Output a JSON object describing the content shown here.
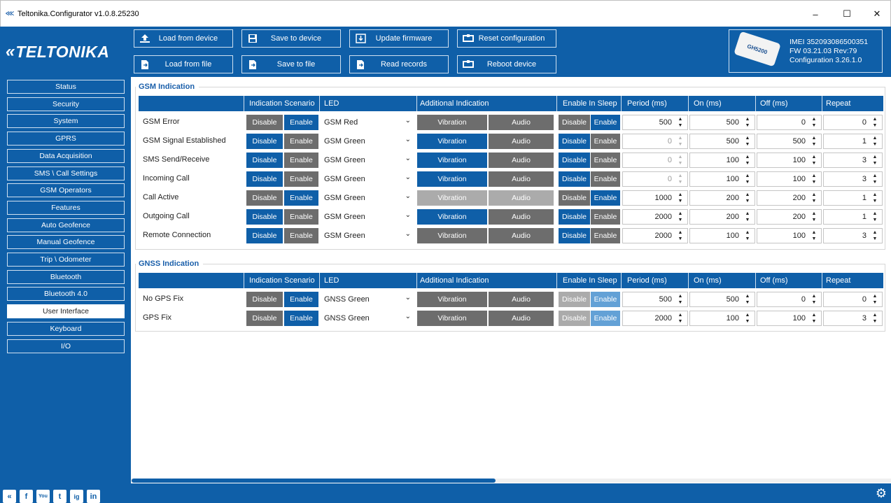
{
  "window": {
    "title": "Teltonika.Configurator v1.0.8.25230",
    "minimize": "–",
    "maximize": "☐",
    "close": "✕"
  },
  "brand": {
    "mark": "«",
    "name": "TELTONIKA"
  },
  "toolbar": {
    "load_device": "Load from device",
    "save_device": "Save to device",
    "update_fw": "Update firmware",
    "reset_cfg": "Reset configuration",
    "load_file": "Load from file",
    "save_file": "Save to file",
    "read_records": "Read records",
    "reboot": "Reboot device"
  },
  "device": {
    "model": "GH5200",
    "imei": "IMEI 352093086500351",
    "fw": "FW 03.21.03 Rev:79",
    "config": "Configuration 3.26.1.0"
  },
  "sidebar": {
    "items": [
      "Status",
      "Security",
      "System",
      "GPRS",
      "Data Acquisition",
      "SMS \\ Call Settings",
      "GSM Operators",
      "Features",
      "Auto Geofence",
      "Manual Geofence",
      "Trip \\ Odometer",
      "Bluetooth",
      "Bluetooth 4.0",
      "User Interface",
      "Keyboard",
      "I/O"
    ],
    "active": "User Interface"
  },
  "social": [
    "«",
    "f",
    "You",
    "t",
    "ig",
    "in"
  ],
  "columns": {
    "scenario": "Indication Scenario",
    "led": "LED",
    "additional": "Additional Indication",
    "sleep": "Enable In Sleep",
    "period": "Period (ms)",
    "on": "On (ms)",
    "off": "Off (ms)",
    "repeat": "Repeat"
  },
  "labels": {
    "disable": "Disable",
    "enable": "Enable",
    "vibration": "Vibration",
    "audio": "Audio"
  },
  "gsm": {
    "title": "GSM Indication",
    "rows": [
      {
        "name": "GSM Error",
        "scenario": "Enable",
        "led": "GSM Red",
        "vibration": "off",
        "audio": "off",
        "sleep": "Enable",
        "period": "500",
        "on": "500",
        "off": "0",
        "repeat": "0"
      },
      {
        "name": "GSM Signal Established",
        "scenario": "Disable",
        "led": "GSM Green",
        "vibration": "on",
        "audio": "off",
        "sleep": "Disable",
        "period": "0",
        "on": "500",
        "off": "500",
        "repeat": "1"
      },
      {
        "name": "SMS Send/Receive",
        "scenario": "Disable",
        "led": "GSM Green",
        "vibration": "on",
        "audio": "off",
        "sleep": "Disable",
        "period": "0",
        "on": "100",
        "off": "100",
        "repeat": "3"
      },
      {
        "name": "Incoming Call",
        "scenario": "Disable",
        "led": "GSM Green",
        "vibration": "on",
        "audio": "off",
        "sleep": "Disable",
        "period": "0",
        "on": "100",
        "off": "100",
        "repeat": "3"
      },
      {
        "name": "Call Active",
        "scenario": "Enable",
        "led": "GSM Green",
        "vibration": "disabled",
        "audio": "disabled",
        "sleep": "Enable",
        "period": "1000",
        "on": "200",
        "off": "200",
        "repeat": "1"
      },
      {
        "name": "Outgoing Call",
        "scenario": "Disable",
        "led": "GSM Green",
        "vibration": "on",
        "audio": "off",
        "sleep": "Disable",
        "period": "2000",
        "on": "200",
        "off": "200",
        "repeat": "1"
      },
      {
        "name": "Remote Connection",
        "scenario": "Disable",
        "led": "GSM Green",
        "vibration": "off",
        "audio": "off",
        "sleep": "Disable",
        "period": "2000",
        "on": "100",
        "off": "100",
        "repeat": "3"
      }
    ]
  },
  "gnss": {
    "title": "GNSS Indication",
    "rows": [
      {
        "name": "No GPS Fix",
        "scenario": "Enable",
        "led": "GNSS Green",
        "vibration": "off",
        "audio": "off",
        "sleep": "light",
        "period": "500",
        "on": "500",
        "off": "0",
        "repeat": "0"
      },
      {
        "name": "GPS Fix",
        "scenario": "Enable",
        "led": "GNSS Green",
        "vibration": "off",
        "audio": "off",
        "sleep": "light",
        "period": "2000",
        "on": "100",
        "off": "100",
        "repeat": "3"
      }
    ]
  },
  "colors": {
    "brand_blue": "#0f5fa8",
    "gray": "#6d6d6d",
    "light_gray": "#ababab",
    "light_blue": "#63a1d6"
  }
}
